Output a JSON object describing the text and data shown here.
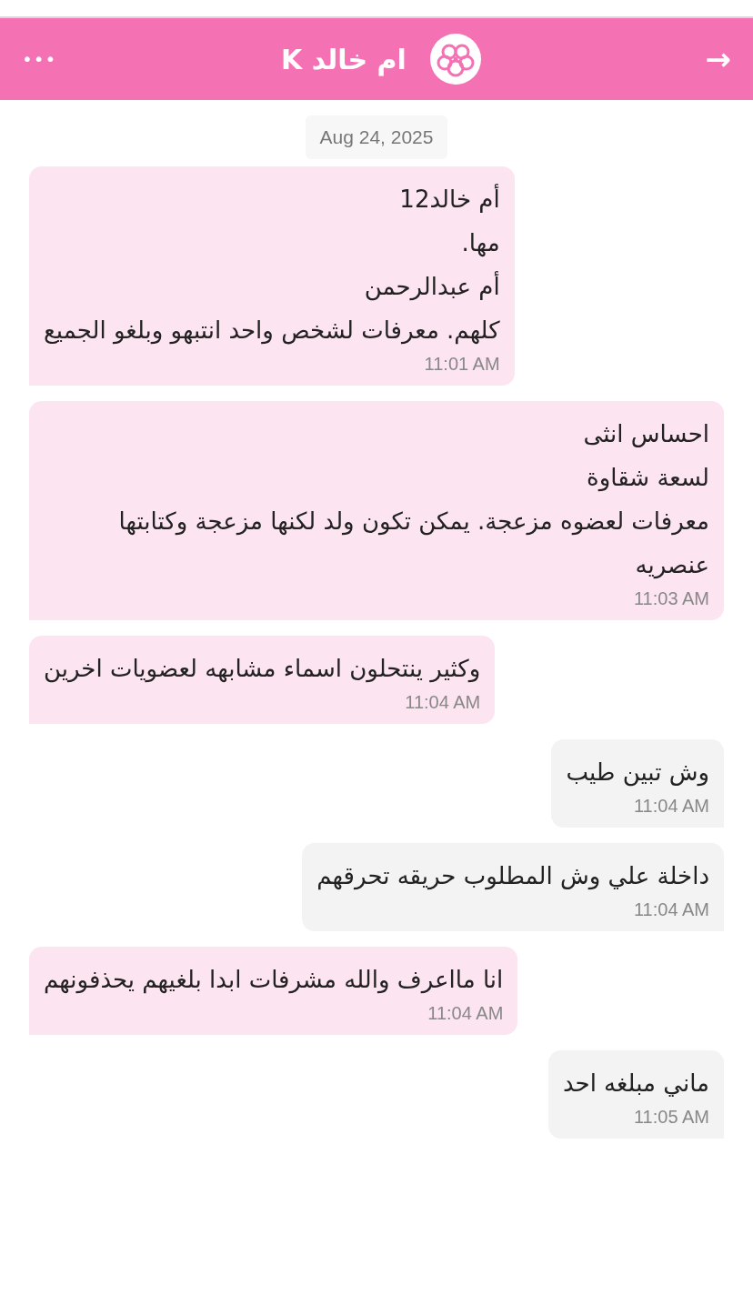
{
  "header": {
    "menu": "•••",
    "title": "ام خالد K",
    "back": "→"
  },
  "date": "Aug 24, 2025",
  "messages": [
    {
      "kind": "incoming",
      "lines": [
        "أم خالد12",
        "مها.",
        "أم عبدالرحمن",
        "كلهم. معرفات لشخص واحد انتبهو وبلغو الجميع"
      ],
      "time": "11:01 AM"
    },
    {
      "kind": "incoming",
      "lines": [
        "احساس انثى",
        "لسعة شقاوة",
        "معرفات لعضوه مزعجة. يمكن تكون ولد لكنها مزعجة وكتابتها عنصريه"
      ],
      "time": "11:03 AM"
    },
    {
      "kind": "incoming",
      "lines": [
        "وكثير ينتحلون اسماء مشابهه لعضويات اخرين"
      ],
      "time": "11:04 AM"
    },
    {
      "kind": "outgoing",
      "lines": [
        "وش تبين طيب"
      ],
      "time": "11:04 AM"
    },
    {
      "kind": "outgoing",
      "lines": [
        "داخلة علي وش المطلوب حريقه تحرقهم"
      ],
      "time": "11:04 AM"
    },
    {
      "kind": "incoming",
      "lines": [
        "انا مااعرف والله مشرفات ابدا بلغيهم يحذفونهم"
      ],
      "time": "11:04 AM"
    },
    {
      "kind": "outgoing",
      "lines": [
        "ماني مبلغه احد"
      ],
      "time": "11:05 AM"
    }
  ]
}
